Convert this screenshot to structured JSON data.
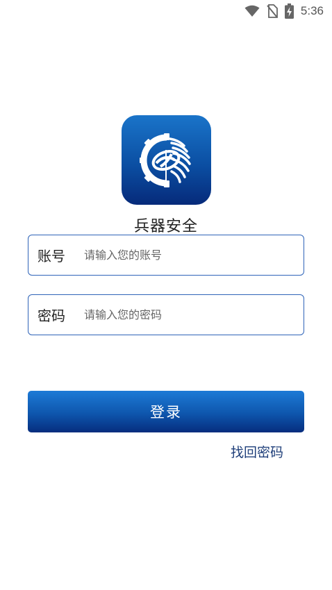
{
  "status_bar": {
    "time": "5:36",
    "icons": [
      "wifi-icon",
      "no-sim-icon",
      "battery-charging-icon"
    ]
  },
  "app": {
    "name": "兵器安全",
    "logo_icon": "gear-wheat-emblem-icon",
    "brand_color": "#0b4fa3"
  },
  "form": {
    "account": {
      "label": "账号",
      "placeholder": "请输入您的账号",
      "value": ""
    },
    "password": {
      "label": "密码",
      "placeholder": "请输入您的密码",
      "value": ""
    },
    "login_label": "登录",
    "find_password_label": "找回密码"
  }
}
